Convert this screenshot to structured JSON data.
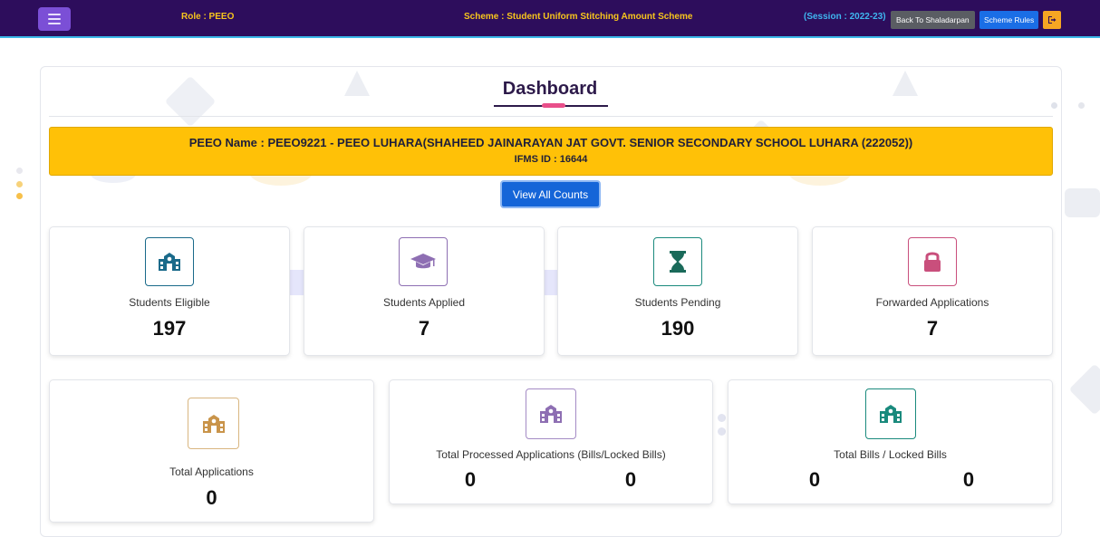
{
  "topbar": {
    "role": "Role : PEEO",
    "scheme": "Scheme : Student Uniform Stitching Amount Scheme",
    "session": "(Session : 2022-23)",
    "back_label": "Back To Shaladarpan",
    "rules_label": "Scheme Rules",
    "menu_icon": "hamburger-icon",
    "logout_icon": "logout-icon"
  },
  "dashboard": {
    "title": "Dashboard",
    "banner": {
      "peeo_line": "PEEO Name : PEEO9221 - PEEO LUHARA(SHAHEED JAINARAYAN JAT GOVT. SENIOR SECONDARY SCHOOL LUHARA (222052))",
      "ifms_line": "IFMS ID : 16644"
    },
    "view_all_label": "View All Counts"
  },
  "cards_row1": [
    {
      "label": "Students Eligible",
      "value": "197",
      "icon": "school-icon",
      "color": "#1a6a8a"
    },
    {
      "label": "Students Applied",
      "value": "7",
      "icon": "graduation-cap-icon",
      "color": "#8e6fb3"
    },
    {
      "label": "Students Pending",
      "value": "190",
      "icon": "hourglass-icon",
      "color": "#1a8a7d"
    },
    {
      "label": "Forwarded Applications",
      "value": "7",
      "icon": "lock-icon",
      "color": "#c94f7c"
    }
  ],
  "cards_row2": [
    {
      "label": "Total Applications",
      "value": "0",
      "icon": "school-icon",
      "color": "#c9944a"
    },
    {
      "label": "Total Processed Applications (Bills/Locked Bills)",
      "value_left": "0",
      "value_right": "0",
      "icon": "school-icon",
      "color": "#8e6fb3"
    },
    {
      "label": "Total Bills / Locked Bills",
      "value_left": "0",
      "value_right": "0",
      "icon": "school-icon",
      "color": "#1a8a7d"
    }
  ]
}
